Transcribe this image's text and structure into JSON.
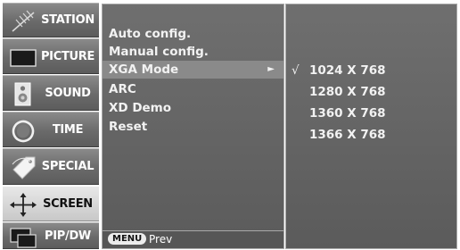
{
  "sidebar": {
    "items": [
      {
        "label": "STATION",
        "icon": "antenna-icon",
        "active": false
      },
      {
        "label": "PICTURE",
        "icon": "monitor-icon",
        "active": false
      },
      {
        "label": "SOUND",
        "icon": "speaker-icon",
        "active": false
      },
      {
        "label": "TIME",
        "icon": "clock-icon",
        "active": false
      },
      {
        "label": "SPECIAL",
        "icon": "tag-icon",
        "active": false
      },
      {
        "label": "SCREEN",
        "icon": "move-arrows-icon",
        "active": true
      },
      {
        "label": "PIP/DW",
        "icon": "pip-icon",
        "active": false
      }
    ]
  },
  "menu": {
    "items": [
      {
        "label": "Auto config."
      },
      {
        "label": "Manual config."
      },
      {
        "label": "XGA Mode",
        "highlighted": true,
        "arrow": "►"
      },
      {
        "label": "ARC"
      },
      {
        "label": "XD Demo"
      },
      {
        "label": "Reset"
      }
    ],
    "footer": {
      "key_label": "MENU",
      "prev_label": "Prev"
    }
  },
  "xga": {
    "options": [
      {
        "label": "1024 X 768",
        "checked": true,
        "check": "√"
      },
      {
        "label": "1280 X 768",
        "checked": false
      },
      {
        "label": "1360 X 768",
        "checked": false
      },
      {
        "label": "1366 X 768",
        "checked": false
      }
    ]
  },
  "colors": {
    "panel": "#666666",
    "highlight": "#8a8a8a",
    "active_tab": "#d8d8d8",
    "text": "#f2f2f2"
  }
}
